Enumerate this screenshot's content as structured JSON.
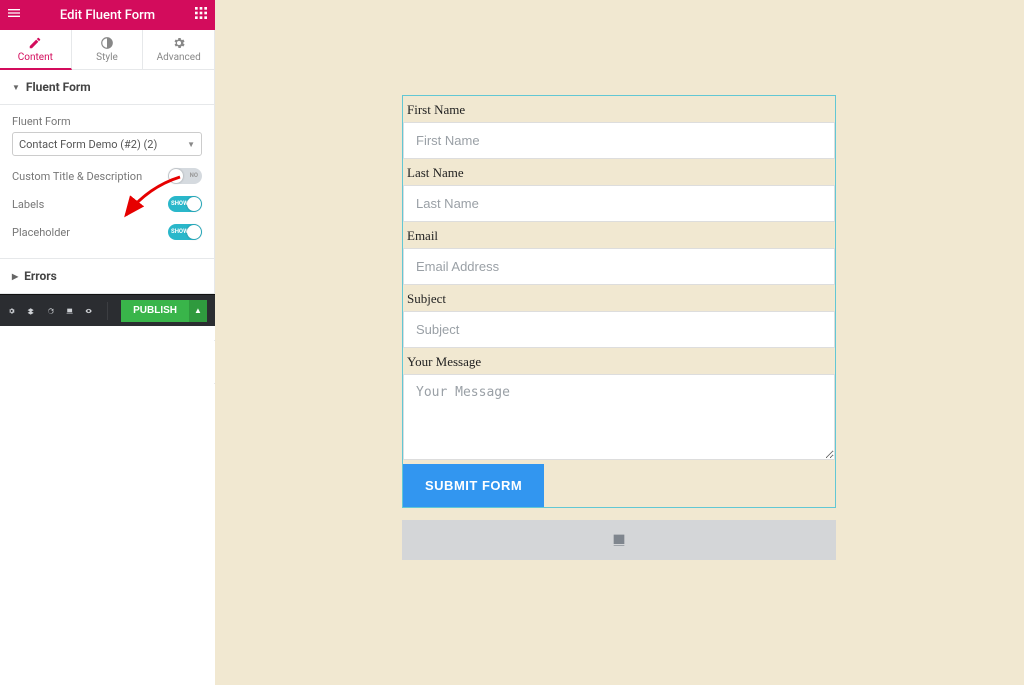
{
  "header": {
    "title": "Edit Fluent Form"
  },
  "tabs": {
    "content": "Content",
    "style": "Style",
    "advanced": "Advanced"
  },
  "section": {
    "title": "Fluent Form"
  },
  "controls": {
    "fluent_form_label": "Fluent Form",
    "fluent_form_value": "Contact Form Demo (#2) (2)",
    "custom_title_label": "Custom Title & Description",
    "custom_title_toggle": "NO",
    "labels_label": "Labels",
    "labels_toggle": "SHOW",
    "placeholder_label": "Placeholder",
    "placeholder_toggle": "SHOW"
  },
  "errors_section": {
    "title": "Errors"
  },
  "footer": {
    "publish": "PUBLISH"
  },
  "form": {
    "first_name": {
      "label": "First Name",
      "placeholder": "First Name"
    },
    "last_name": {
      "label": "Last Name",
      "placeholder": "Last Name"
    },
    "email": {
      "label": "Email",
      "placeholder": "Email Address"
    },
    "subject": {
      "label": "Subject",
      "placeholder": "Subject"
    },
    "message": {
      "label": "Your Message",
      "placeholder": "Your Message"
    },
    "submit": "SUBMIT FORM"
  }
}
